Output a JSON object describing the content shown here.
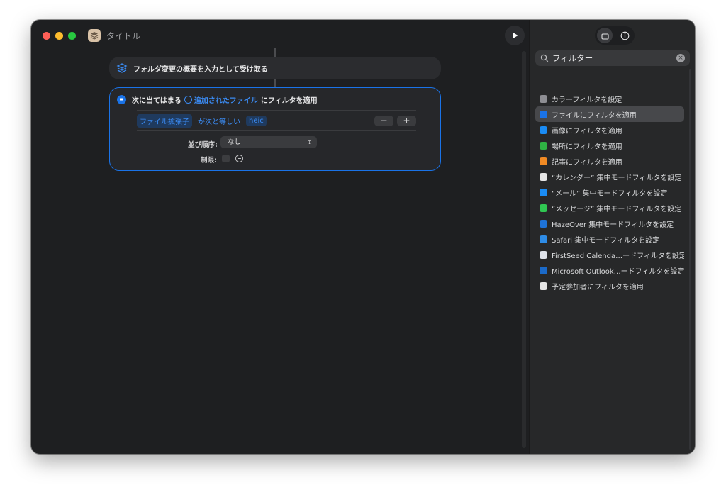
{
  "window": {
    "title": "タイトル"
  },
  "workflow": {
    "action1": {
      "label": "フォルダ変更の概要を入力として受け取る"
    },
    "action2": {
      "prefix": "次に当てはまる",
      "param": "追加されたファイル",
      "suffix": "にフィルタを適用",
      "condition": {
        "field": "ファイル拡張子",
        "operator": "が次と等しい",
        "value": "heic"
      },
      "minus_label": "−",
      "plus_label": "+",
      "sort_label": "並び順序:",
      "sort_value": "なし",
      "limit_label": "制限:"
    }
  },
  "sidebar": {
    "search": {
      "value": "フィルター",
      "clear": "×"
    },
    "results": [
      {
        "label": "カラーフィルタを設定",
        "color": "#8e8e93"
      },
      {
        "label": "ファイルにフィルタを適用",
        "color": "#1a73e8"
      },
      {
        "label": "画像にフィルタを適用",
        "color": "#1a8cf5"
      },
      {
        "label": "場所にフィルタを適用",
        "color": "#2fb344"
      },
      {
        "label": "記事にフィルタを適用",
        "color": "#f08a24"
      },
      {
        "label": "“カレンダー” 集中モードフィルタを設定",
        "color": "#e6e6e6"
      },
      {
        "label": "“メール” 集中モードフィルタを設定",
        "color": "#1a8cf5"
      },
      {
        "label": "“メッセージ” 集中モードフィルタを設定",
        "color": "#30c752"
      },
      {
        "label": "HazeOver 集中モードフィルタを設定",
        "color": "#1e73d8"
      },
      {
        "label": "Safari 集中モードフィルタを設定",
        "color": "#2e8ce6"
      },
      {
        "label": "FirstSeed Calenda…ードフィルタを設定",
        "color": "#dfe3ea"
      },
      {
        "label": "Microsoft Outlook…ードフィルタを設定",
        "color": "#1b6ac9"
      },
      {
        "label": "予定参加者にフィルタを適用",
        "color": "#e6e6e6"
      }
    ]
  }
}
